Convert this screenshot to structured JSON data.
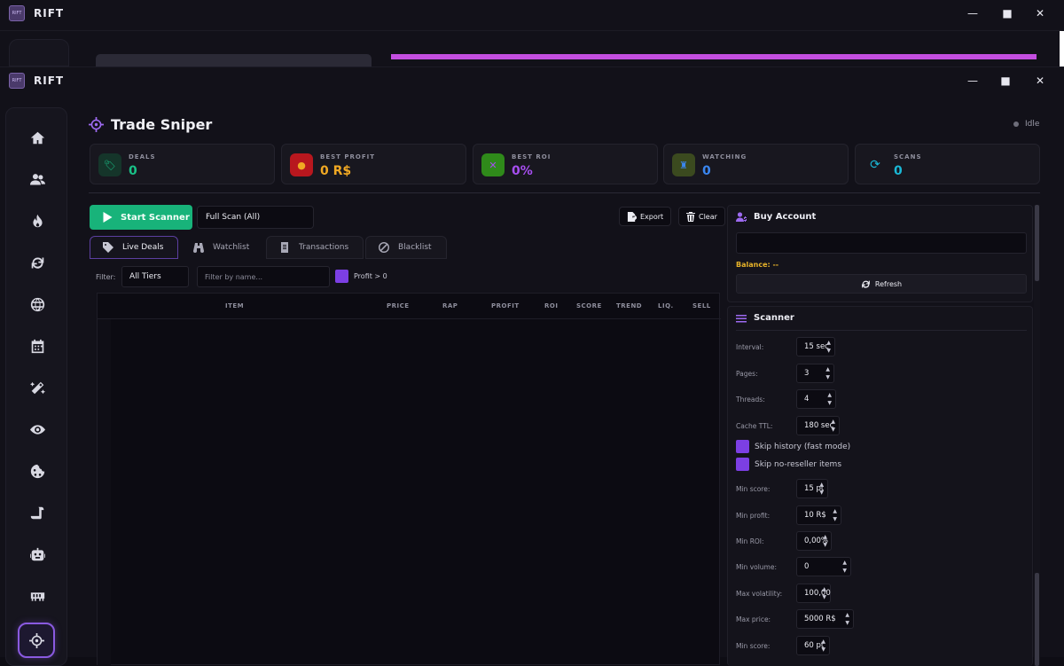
{
  "app": {
    "name": "RIFT",
    "logo_text": "RIFT"
  },
  "window_controls": {
    "minimize": "—",
    "maximize": "■",
    "close": "✕"
  },
  "page": {
    "title": "Trade Sniper",
    "status": "Idle"
  },
  "stats": [
    {
      "label": "DEALS",
      "value": "0",
      "color": "#19c187",
      "icon": "tag-icon"
    },
    {
      "label": "BEST PROFIT",
      "value": "0 R$",
      "color": "#f0a823",
      "icon": "coins-icon"
    },
    {
      "label": "BEST ROI",
      "value": "0%",
      "color": "#a64ef0",
      "icon": "percent-icon"
    },
    {
      "label": "WATCHING",
      "value": "0",
      "color": "#3a86f0",
      "icon": "binoculars-icon"
    },
    {
      "label": "SCANS",
      "value": "0",
      "color": "#1ab8d6",
      "icon": "refresh-icon"
    }
  ],
  "toolbar": {
    "start_label": "Start Scanner",
    "scan_mode": "Full Scan (All)",
    "export_label": "Export",
    "clear_label": "Clear"
  },
  "tabs": [
    {
      "label": "Live Deals",
      "icon": "tags-icon",
      "active": true
    },
    {
      "label": "Watchlist",
      "icon": "binoculars-icon",
      "active": false
    },
    {
      "label": "Transactions",
      "icon": "receipt-icon",
      "active": false
    },
    {
      "label": "Blacklist",
      "icon": "ban-icon",
      "active": false
    }
  ],
  "filter": {
    "label": "Filter:",
    "tier": "All Tiers",
    "name_placeholder": "Filter by name...",
    "profit_label": "Profit > 0"
  },
  "table": {
    "columns": [
      "ITEM",
      "PRICE",
      "RAP",
      "PROFIT",
      "ROI",
      "SCORE",
      "TREND",
      "LIQ.",
      "SELL"
    ],
    "rows": []
  },
  "buy_account": {
    "title": "Buy Account",
    "balance": "Balance: --",
    "refresh_label": "Refresh"
  },
  "scanner": {
    "title": "Scanner",
    "fields": [
      {
        "label": "Interval:",
        "value": "15 sec"
      },
      {
        "label": "Pages:",
        "value": "3"
      },
      {
        "label": "Threads:",
        "value": "4"
      },
      {
        "label": "Cache TTL:",
        "value": "180 sec"
      }
    ],
    "checks": [
      {
        "label": "Skip history (fast mode)",
        "checked": true
      },
      {
        "label": "Skip no-reseller items",
        "checked": true
      }
    ],
    "fields2": [
      {
        "label": "Min score:",
        "value": "15 pt"
      },
      {
        "label": "Min profit:",
        "value": "10 R$"
      },
      {
        "label": "Min ROI:",
        "value": "0,00%"
      },
      {
        "label": "Min volume:",
        "value": "0"
      },
      {
        "label": "Max volatility:",
        "value": "100,00"
      },
      {
        "label": "Max price:",
        "value": "5000 R$"
      },
      {
        "label": "Min score:",
        "value": "60 pt"
      }
    ]
  },
  "colors": {
    "accent": "#8a5ae0",
    "start_button": "#18b37a",
    "balance": "#e6b229",
    "back_progress": "#c44ee0"
  }
}
